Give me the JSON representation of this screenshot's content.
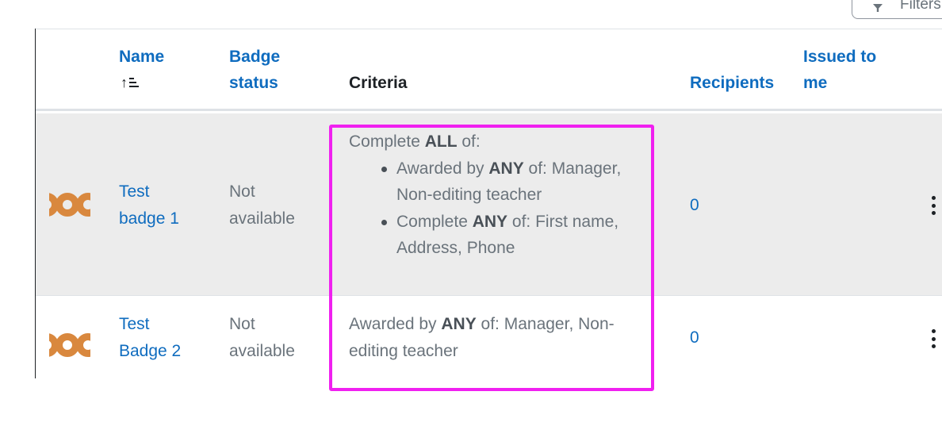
{
  "filter_button": {
    "label": "Filters",
    "icon": "filter-icon"
  },
  "table": {
    "headers": {
      "name": "Name",
      "badge_status": "Badge status",
      "criteria": "Criteria",
      "recipients": "Recipients",
      "issued_to_me": "Issued to me",
      "name_sort_icon": "sort-ascending-icon"
    },
    "rows": [
      {
        "name_line1": "Test",
        "name_line2": "badge 1",
        "status_line1": "Not",
        "status_line2": "available",
        "criteria_intro_pre": "Complete ",
        "criteria_intro_bold": "ALL",
        "criteria_intro_post": " of:",
        "criteria_items": [
          {
            "line1_pre": "Awarded by ",
            "bold": "ANY",
            "line1_post": " of: Manager,",
            "line2": "Non-editing teacher"
          },
          {
            "line1_pre": "Complete ",
            "bold": "ANY",
            "line1_post": " of: First name,",
            "line2": "Address, Phone"
          }
        ],
        "recipients": "0"
      },
      {
        "name_line1": "Test",
        "name_line2": "Badge 2",
        "status_line1": "Not",
        "status_line2": "available",
        "criteria_line1_pre": "Awarded by ",
        "criteria_line1_bold": "ANY",
        "criteria_line1_post": " of: Manager, Non-",
        "criteria_line2": "editing teacher",
        "recipients": "0"
      }
    ]
  },
  "colors": {
    "link": "#0f6cbf",
    "highlight": "#f020f0",
    "badge_orange": "#d9883e",
    "row_highlight_bg": "#ececec"
  }
}
